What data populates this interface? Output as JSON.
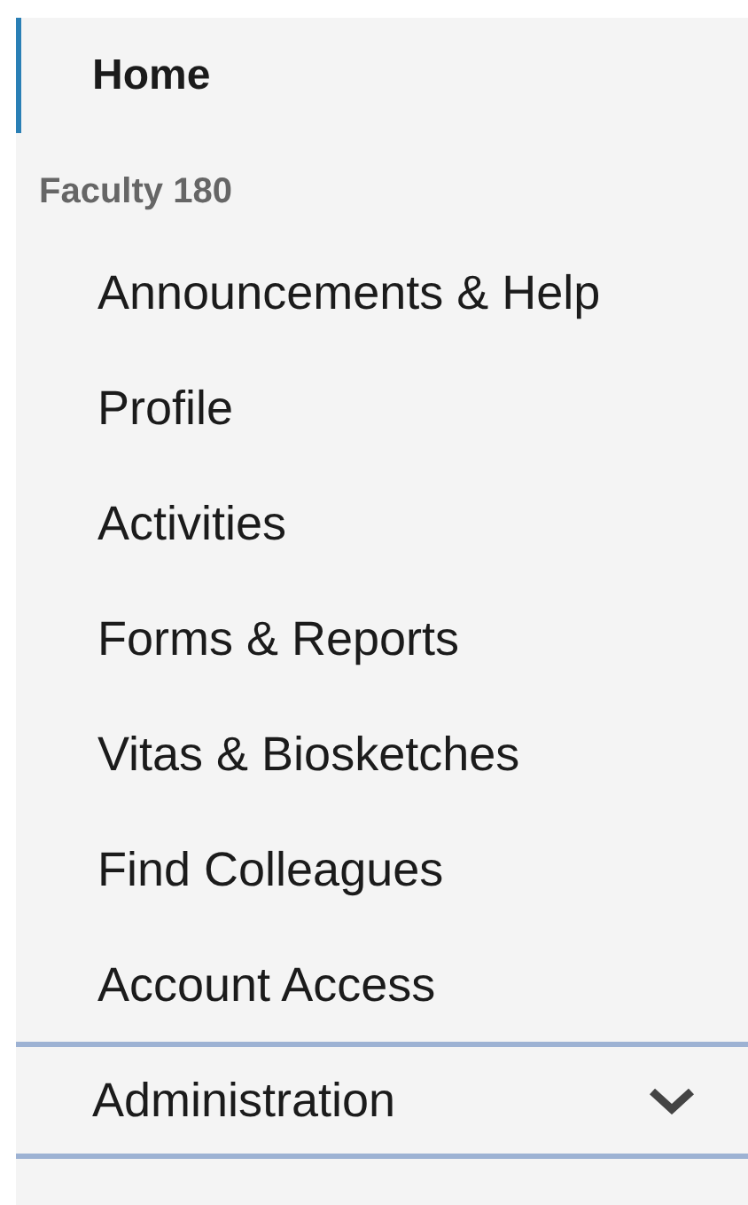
{
  "home": {
    "label": "Home",
    "selected": true
  },
  "section": {
    "label": "Faculty 180"
  },
  "items": [
    {
      "label": "Announcements & Help",
      "selected": false
    },
    {
      "label": "Profile",
      "selected": false
    },
    {
      "label": "Activities",
      "selected": false
    },
    {
      "label": "Forms & Reports",
      "selected": false
    },
    {
      "label": "Vitas & Biosketches",
      "selected": false
    },
    {
      "label": "Find Colleagues",
      "selected": false
    },
    {
      "label": "Account Access",
      "selected": false
    }
  ],
  "administration": {
    "label": "Administration",
    "expanded": false
  }
}
